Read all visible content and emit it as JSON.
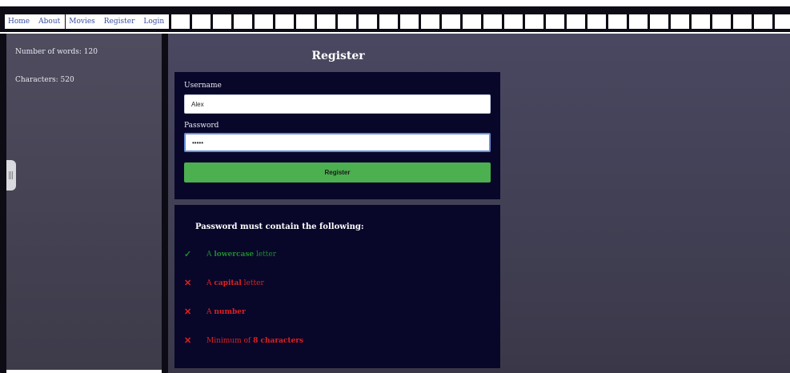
{
  "nav": {
    "items": [
      "Home",
      "About",
      "Movies",
      "Register",
      "Login"
    ]
  },
  "sidebar": {
    "word_count": "Number of words: 120",
    "char_count": "Characters: 520"
  },
  "page": {
    "title": "Register"
  },
  "form": {
    "username_label": "Username",
    "username_value": "Alex",
    "password_label": "Password",
    "password_value": "•••••",
    "submit_label": "Register"
  },
  "requirements": {
    "title": "Password must contain the following:",
    "items": [
      {
        "mark": "✓",
        "pre": "A ",
        "strong": "lowercase",
        "post": " letter",
        "status": "met"
      },
      {
        "mark": "✕",
        "pre": "A ",
        "strong": "capital",
        "post": " letter",
        "status": "unmet"
      },
      {
        "mark": "✕",
        "pre": "A ",
        "strong": "number",
        "post": "",
        "status": "unmet"
      },
      {
        "mark": "✕",
        "pre": "Minimum of ",
        "strong": "8 characters",
        "post": "",
        "status": "unmet"
      }
    ]
  },
  "colors": {
    "ok": "#1f8a2a",
    "bad": "#e02020",
    "button": "#4caf50",
    "card": "#08072a"
  }
}
